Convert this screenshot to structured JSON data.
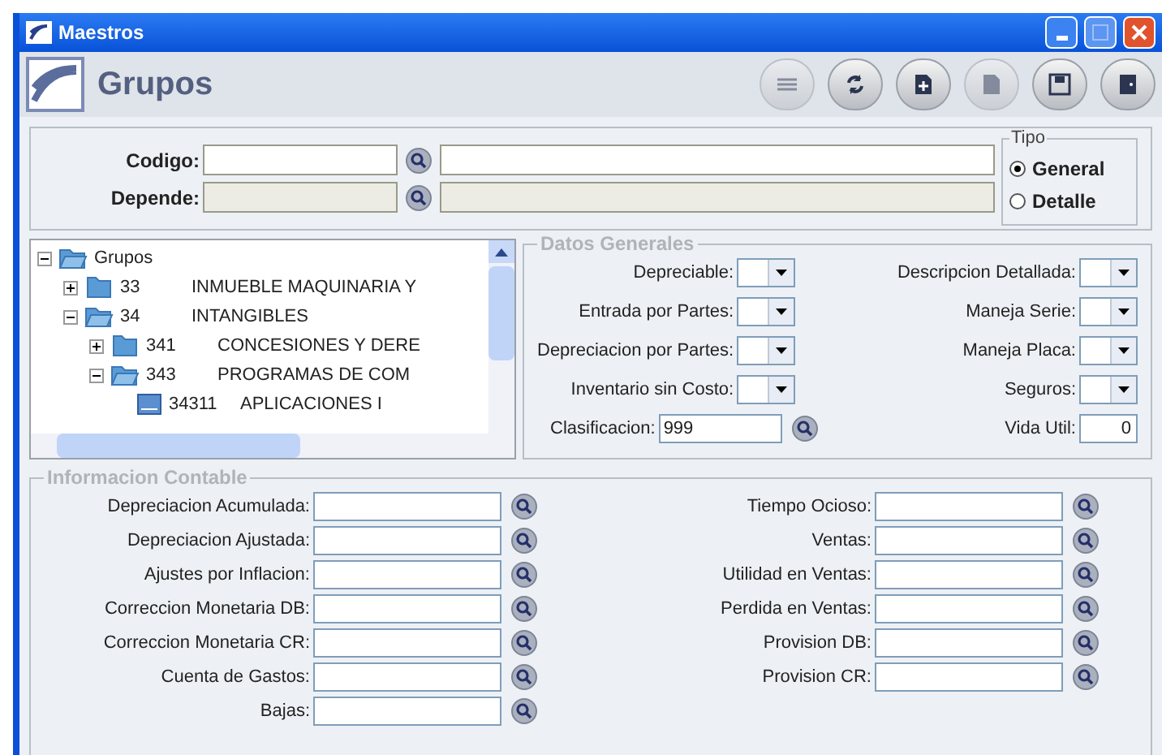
{
  "window": {
    "title": "Maestros"
  },
  "header": {
    "title": "Grupos"
  },
  "toolbar": [
    {
      "kind": "list",
      "disabled": true
    },
    {
      "kind": "refresh",
      "disabled": false
    },
    {
      "kind": "new",
      "disabled": false
    },
    {
      "kind": "edit",
      "disabled": true
    },
    {
      "kind": "save",
      "disabled": false
    },
    {
      "kind": "exit",
      "disabled": false
    }
  ],
  "filters": [
    {
      "label": "Codigo:",
      "disabled": false
    },
    {
      "label": "Depende:",
      "disabled": true
    }
  ],
  "tipo": {
    "title": "Tipo",
    "options": [
      {
        "label": "General",
        "selected": true
      },
      {
        "label": "Detalle",
        "selected": false
      }
    ]
  },
  "tree": {
    "label": "Grupos",
    "expanded": true,
    "children": [
      {
        "code": "33",
        "name": "INMUEBLE MAQUINARIA Y",
        "expanded": false
      },
      {
        "code": "34",
        "name": "INTANGIBLES",
        "expanded": true,
        "children": [
          {
            "code": "341",
            "name": "CONCESIONES Y DERE",
            "expanded": false
          },
          {
            "code": "343",
            "name": "PROGRAMAS DE COM",
            "expanded": true,
            "children": [
              {
                "code": "34311",
                "name": "APLICACIONES I"
              }
            ]
          }
        ]
      }
    ]
  },
  "datos_generales": {
    "title": "Datos Generales",
    "left": [
      {
        "label": "Depreciable:"
      },
      {
        "label": "Entrada por Partes:"
      },
      {
        "label": "Depreciacion por Partes:"
      },
      {
        "label": "Inventario sin Costo:"
      }
    ],
    "right": [
      {
        "label": "Descripcion Detallada:"
      },
      {
        "label": "Maneja Serie:"
      },
      {
        "label": "Maneja Placa:"
      },
      {
        "label": "Seguros:"
      }
    ],
    "clasificacion": {
      "label": "Clasificacion:",
      "value": "999"
    },
    "vida_util": {
      "label": "Vida Util:",
      "value": "0"
    }
  },
  "informacion_contable": {
    "title": "Informacion Contable",
    "left": [
      {
        "label": "Depreciacion Acumulada:"
      },
      {
        "label": "Depreciacion Ajustada:"
      },
      {
        "label": "Ajustes por Inflacion:"
      },
      {
        "label": "Correccion Monetaria DB:"
      },
      {
        "label": "Correccion Monetaria CR:"
      },
      {
        "label": "Cuenta de Gastos:"
      },
      {
        "label": "Bajas:"
      }
    ],
    "right": [
      {
        "label": "Tiempo Ocioso:"
      },
      {
        "label": "Ventas:"
      },
      {
        "label": "Utilidad en Ventas:"
      },
      {
        "label": "Perdida en Ventas:"
      },
      {
        "label": "Provision DB:"
      },
      {
        "label": "Provision CR:"
      }
    ]
  }
}
